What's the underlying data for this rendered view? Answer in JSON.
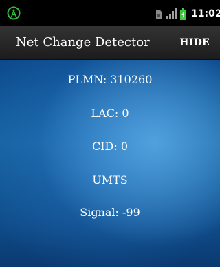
{
  "status_bar": {
    "time": "11:02",
    "app_icon": "antenna-tower-icon",
    "sim_icon": "sim-card-icon",
    "signal_icon": "signal-strength-icon",
    "battery_icon": "battery-charging-icon",
    "colors": {
      "app_icon": "#2fbf3a",
      "battery": "#3ec63e"
    }
  },
  "action_bar": {
    "title": "Net Change Detector",
    "hide_label": "HIDE"
  },
  "info": {
    "plmn": "PLMN: 310260",
    "lac": "LAC: 0",
    "cid": "CID: 0",
    "network_type": "UMTS",
    "signal": "Signal: -99"
  }
}
